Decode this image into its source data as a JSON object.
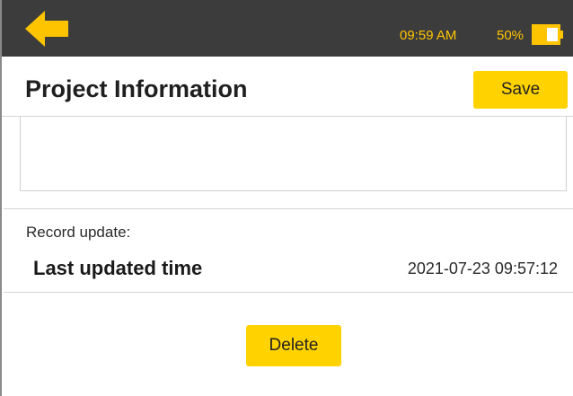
{
  "status_bar": {
    "time": "09:59 AM",
    "battery_percent": "50%",
    "accent_color": "#ffc400",
    "background_color": "#3c3c3c",
    "back_icon": "arrow-left-icon",
    "battery_icon": "battery-icon",
    "battery_level": 0.5
  },
  "header": {
    "title": "Project Information",
    "save_label": "Save",
    "button_color": "#ffd200"
  },
  "notes": {
    "value": ""
  },
  "record": {
    "section_label": "Record update:",
    "last_updated_label": "Last updated time",
    "last_updated_value": "2021-07-23 09:57:12"
  },
  "actions": {
    "delete_label": "Delete"
  }
}
